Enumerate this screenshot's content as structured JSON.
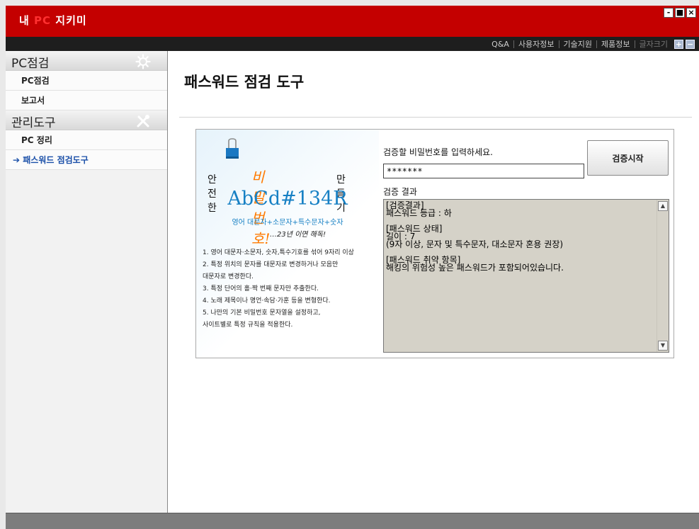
{
  "app": {
    "title_prefix": "내 ",
    "title_accent": "PC",
    "title_suffix": " 지키미",
    "window_buttons": {
      "minimize": "-",
      "maximize": "■",
      "close": "×"
    }
  },
  "menu": {
    "items": [
      "Q&A",
      "사용자정보",
      "기술지원",
      "제품정보"
    ],
    "font_size_label": "글자크기",
    "font_increase": "+",
    "font_decrease": "−"
  },
  "sidebar": {
    "sections": [
      {
        "title": "PC점검",
        "icon": "gear-icon",
        "items": [
          "PC점검",
          "보고서"
        ]
      },
      {
        "title": "관리도구",
        "icon": "tools-icon",
        "items": [
          "PC 정리",
          "➔ 패스워드 점검도구"
        ]
      }
    ]
  },
  "main": {
    "title": "패스워드 점검 도구"
  },
  "banner": {
    "heading_left": "안전한",
    "heading_script": "비밀번호!",
    "heading_right": "만들기",
    "sample_password": "AbCd#134R",
    "formula": "영어 대문자+소문자+특수문자+숫자",
    "note": "…23년 이면 해독!",
    "tips": [
      "1. 영어 대문자·소문자, 숫자,특수기호를 섞어 9자리 이상",
      "2. 특정 위치의 문자를 대문자로 변경하거나 모음만",
      "    대문자로 변경한다.",
      "3. 특정 단어의 홀·짝 번째 문자만 추출한다.",
      "4. 노래 제목이나 명언·속담·가훈 등을 변형한다.",
      "5. 나만의 기본 비밀번호 문자열을 설정하고,",
      "    사이트별로 특정 규칙을 적용한다."
    ]
  },
  "form": {
    "prompt": "검증할 비밀번호를 입력하세요.",
    "password_value": "*******",
    "verify_button": "검증시작",
    "result_label": "검증 결과",
    "result_text": "[검증결과]\n패스워드 등급 : 하\n\n[패스워드 상태]\n길이 : 7\n(9자 이상, 문자 및 특수문자, 대소문자 혼용 권장)\n\n[패스워드 취약 항목]\n해킹의 위험성 높은 패스워드가 포함되어있습니다.",
    "scroll_up": "▲",
    "scroll_down": "▼"
  },
  "colors": {
    "title_bar": "#c40000",
    "menu_bar": "#1e1e1e",
    "active_link": "#1a4fa8",
    "result_bg": "#d5d2c8",
    "banner_blue": "#1780c4",
    "banner_orange": "#ff7a00"
  }
}
